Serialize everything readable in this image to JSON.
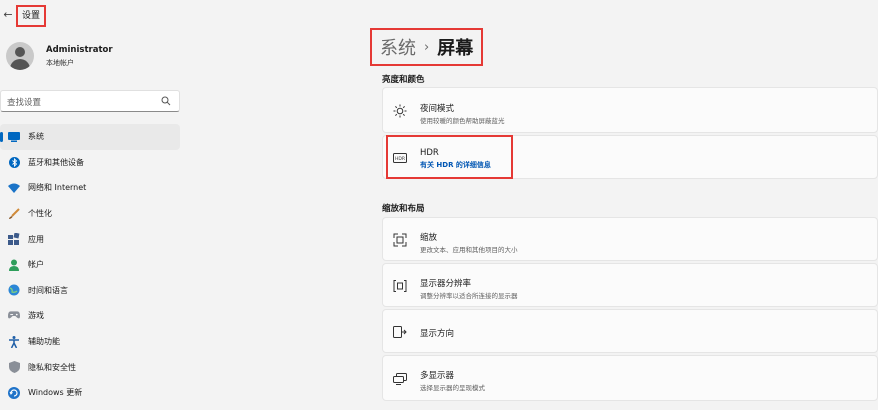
{
  "titlebar": {
    "back_icon": "←",
    "title": "设置"
  },
  "profile": {
    "name": "Administrator",
    "account_type": "本地帐户"
  },
  "search": {
    "placeholder": "查找设置"
  },
  "nav": [
    {
      "label": "系统",
      "icon": "system-icon",
      "active": true
    },
    {
      "label": "蓝牙和其他设备",
      "icon": "bluetooth-icon"
    },
    {
      "label": "网络和 Internet",
      "icon": "wifi-icon"
    },
    {
      "label": "个性化",
      "icon": "brush-icon"
    },
    {
      "label": "应用",
      "icon": "apps-icon"
    },
    {
      "label": "帐户",
      "icon": "account-icon"
    },
    {
      "label": "时间和语言",
      "icon": "globe-icon"
    },
    {
      "label": "游戏",
      "icon": "gamepad-icon"
    },
    {
      "label": "辅助功能",
      "icon": "accessibility-icon"
    },
    {
      "label": "隐私和安全性",
      "icon": "shield-icon"
    },
    {
      "label": "Windows 更新",
      "icon": "update-icon"
    }
  ],
  "breadcrumb": {
    "parent": "系统",
    "separator": "›",
    "current": "屏幕"
  },
  "sections": {
    "brightness": {
      "title": "亮度和颜色",
      "night_light": {
        "title": "夜间模式",
        "subtitle": "使用较暖的颜色帮助屏蔽蓝光"
      },
      "hdr": {
        "title": "HDR",
        "link": "有关 HDR 的详细信息"
      }
    },
    "scale_layout": {
      "title": "缩放和布局",
      "scale": {
        "title": "缩放",
        "subtitle": "更改文本、应用和其他项目的大小"
      },
      "resolution": {
        "title": "显示器分辨率",
        "subtitle": "调整分辨率以适合所连接的显示器"
      },
      "orientation": {
        "title": "显示方向"
      },
      "multiple": {
        "title": "多显示器",
        "subtitle": "选择显示器的呈现模式"
      }
    }
  },
  "colors": {
    "accent": "#0067c0",
    "highlight": "#e53935",
    "background": "#f3f3f3",
    "card": "#fbfbfb"
  }
}
